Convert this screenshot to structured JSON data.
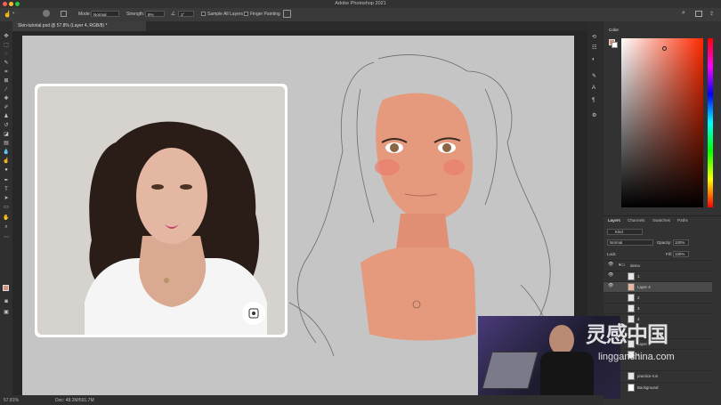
{
  "window": {
    "title": "Adobe Photoshop 2021"
  },
  "options_bar": {
    "mode_label": "Mode:",
    "mode_value": "Normal",
    "strength_label": "Strength:",
    "strength_value": "6%",
    "angle_value": "1°",
    "sample_all_label": "Sample All Layers",
    "finger_painting_label": "Finger Painting"
  },
  "document": {
    "tab_label": "Skin-tutorial.psd @ 57.8% (Layer 4, RGB/8) *"
  },
  "status_bar": {
    "zoom": "57.81%",
    "doc_info": "Doc: 48.2M/591.7M"
  },
  "color_panel": {
    "tab_label": "Color",
    "foreground": "#d9907a",
    "background": "#ffffff"
  },
  "layers_panel": {
    "tabs": [
      "Layers",
      "Channels",
      "Swatches",
      "Paths"
    ],
    "filter_kind": "Kind",
    "blend_mode": "Normal",
    "opacity_label": "Opacity:",
    "opacity_value": "100%",
    "lock_label": "Lock:",
    "fill_label": "Fill:",
    "fill_value": "100%",
    "layers": [
      {
        "name": "demo"
      },
      {
        "name": "1"
      },
      {
        "name": "Layer 4"
      },
      {
        "name": "2"
      },
      {
        "name": "3"
      },
      {
        "name": "4"
      },
      {
        "name": "Layer 1"
      },
      {
        "name": "2"
      },
      {
        "name": "practice-run"
      },
      {
        "name": "Background"
      }
    ]
  },
  "watermark": {
    "chinese": "灵感中国",
    "domain": "lingganchina.com"
  },
  "colors": {
    "skin": "#e59a7e",
    "artboard": "#c5c5c5",
    "panel_bg": "#323232"
  }
}
